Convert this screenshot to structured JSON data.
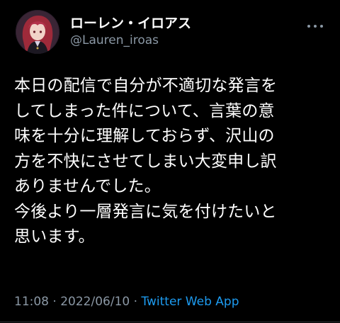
{
  "user": {
    "display_name": "ローレン・イロアス",
    "handle": "@Lauren_iroas"
  },
  "tweet": {
    "lines": [
      "本日の配信で自分が不適切な発言を",
      "してしまった件について、言葉の意",
      "味を十分に理解しておらず、沢山の",
      "方を不快にさせてしまい大変申し訳",
      "ありませんでした。",
      "今後より一層発言に気を付けたいと",
      "思います。"
    ]
  },
  "meta": {
    "time": "11:08",
    "sep1": " · ",
    "date": "2022/06/10",
    "sep2": " · ",
    "source": "Twitter Web App"
  },
  "icons": {
    "avatar": "avatar",
    "more": "more-options-icon"
  },
  "colors": {
    "background": "#000000",
    "text": "#ffffff",
    "secondary": "#8b98a5",
    "link": "#1d9bf0"
  }
}
